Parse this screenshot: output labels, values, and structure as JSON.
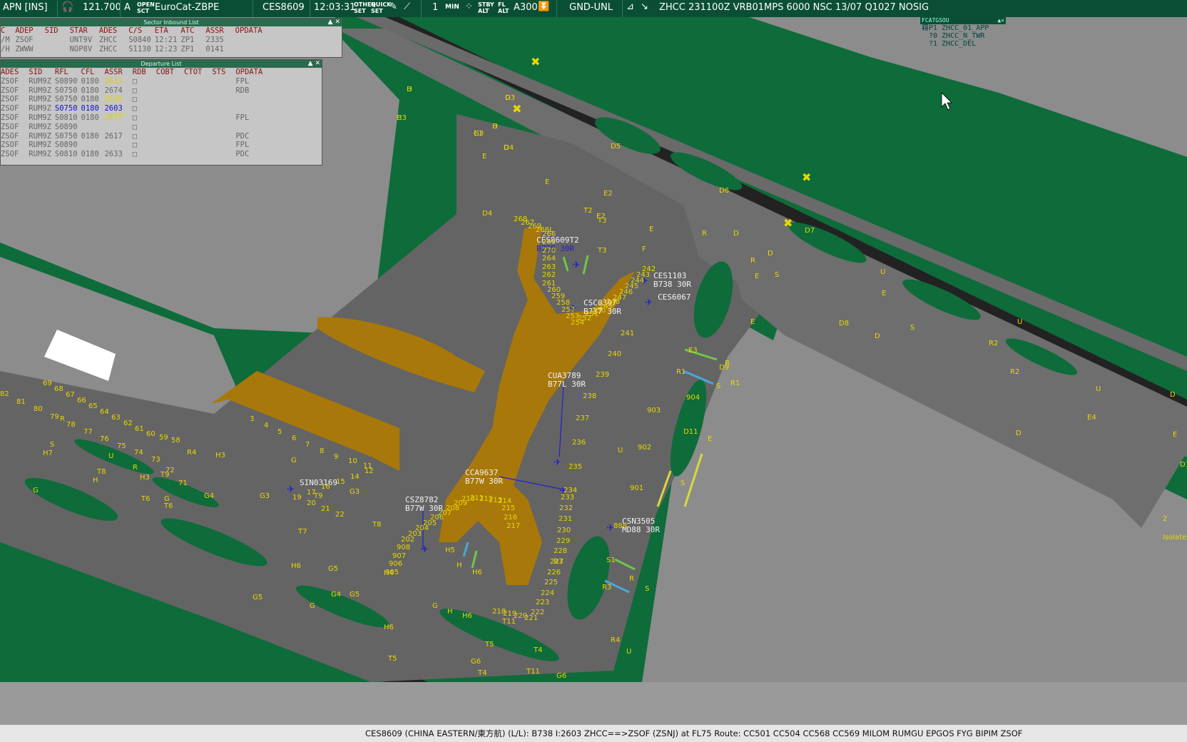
{
  "topbar": {
    "position_label": "APN [INS]",
    "frequency": "121.700",
    "mode": "A",
    "open_sct": [
      "OPEN",
      "SCT"
    ],
    "system_name": "EuroCat-ZBPE",
    "callsign": "CES8609",
    "time": "12:03:31",
    "other_set": [
      "OTHER",
      "SET"
    ],
    "quick_set": [
      "QUICK",
      "SET"
    ],
    "range_value": "1",
    "min_label": "MIN",
    "stby_alt": [
      "STBY",
      "ALT"
    ],
    "fl_alt": [
      "FL",
      "ALT"
    ],
    "alt_filter": "A300",
    "unit_label": "GND-UNL",
    "metar": "ZHCC 231100Z VRB01MPS 6000 NSC 13/07 Q1027 NOSIG"
  },
  "inbound_list": {
    "title": "Sector Inbound List",
    "columns": [
      "C",
      "ADEP",
      "SID",
      "STAR",
      "ADES",
      "C/S",
      "ETA",
      "ATC",
      "ASSR",
      "OPDATA"
    ],
    "rows": [
      [
        "/M",
        "ZSOF",
        "",
        "UNT9V",
        "ZHCC",
        "S0840",
        "12:21",
        "ZP1",
        "2335",
        ""
      ],
      [
        "/H",
        "ZWWW",
        "",
        "NOP8V",
        "ZHCC",
        "S1130",
        "12:23",
        "ZP1",
        "0141",
        ""
      ]
    ]
  },
  "departure_list": {
    "title": "Departure List",
    "columns": [
      "ADES",
      "SID",
      "RFL",
      "CFL",
      "ASSR",
      "RDB",
      "COBT",
      "CTOT",
      "STS",
      "OPDATA"
    ],
    "rows": [
      {
        "ades": "ZSOF",
        "sid": "RUM9Z",
        "rfl": "S0890",
        "cfl": "0180",
        "assr": "2613",
        "rdb": "□",
        "opdata": "FPL",
        "hl": "assr"
      },
      {
        "ades": "ZSOF",
        "sid": "RUM9Z",
        "rfl": "S0750",
        "cfl": "0180",
        "assr": "2674",
        "rdb": "□",
        "opdata": "RDB",
        "hl": ""
      },
      {
        "ades": "ZSOF",
        "sid": "RUM9Z",
        "rfl": "S0750",
        "cfl": "0180",
        "assr": "2636",
        "rdb": "□",
        "opdata": "",
        "hl": "assr"
      },
      {
        "ades": "ZSOF",
        "sid": "RUM9Z",
        "rfl": "S0750",
        "cfl": "0180",
        "assr": "2603",
        "rdb": "□",
        "opdata": "",
        "hl": "blue"
      },
      {
        "ades": "ZSOF",
        "sid": "RUM9Z",
        "rfl": "S0810",
        "cfl": "0180",
        "assr": "2677",
        "rdb": "□",
        "opdata": "FPL",
        "hl": "assr"
      },
      {
        "ades": "ZSOF",
        "sid": "RUM9Z",
        "rfl": "S0890",
        "cfl": "",
        "assr": "",
        "rdb": "□",
        "opdata": "",
        "hl": ""
      },
      {
        "ades": "ZSOF",
        "sid": "RUM9Z",
        "rfl": "S0750",
        "cfl": "0180",
        "assr": "2617",
        "rdb": "□",
        "opdata": "PDC",
        "hl": ""
      },
      {
        "ades": "ZSOF",
        "sid": "RUM9Z",
        "rfl": "S0890",
        "cfl": "",
        "assr": "",
        "rdb": "□",
        "opdata": "FPL",
        "hl": ""
      },
      {
        "ades": "ZSOF",
        "sid": "RUM9Z",
        "rfl": "S0810",
        "cfl": "0180",
        "assr": "2633",
        "rdb": "□",
        "opdata": "PDC",
        "hl": ""
      }
    ]
  },
  "fcat": {
    "header": "FCATGSOU",
    "items": [
      "籍P1 ZHCC_01_APP",
      "?0 ZHCC_N_TWR",
      "?1 ZHCC_DEL"
    ]
  },
  "aircraft": [
    {
      "callsign": "CES8609T2",
      "type": "B738 30R",
      "selected": true
    },
    {
      "callsign": "CES1103",
      "type": "B738 30R",
      "selected": false
    },
    {
      "callsign": "CES6067",
      "type": "",
      "selected": false
    },
    {
      "callsign": "CSC0397",
      "type": "B737 30R",
      "selected": false
    },
    {
      "callsign": "CUA3789",
      "type": "B77L 30R",
      "selected": false
    },
    {
      "callsign": "CCA9637",
      "type": "B77W 30R",
      "selected": false
    },
    {
      "callsign": "CSZ8782",
      "type": "B77W 30R",
      "selected": false
    },
    {
      "callsign": "SIN03169",
      "type": "",
      "selected": false
    },
    {
      "callsign": "CSN3505",
      "type": "MD88 30R",
      "selected": false
    }
  ],
  "map_labels": {
    "taxiways": [
      "D2",
      "D",
      "E",
      "D3",
      "D",
      "E1",
      "D4",
      "E",
      "D5",
      "E",
      "E2",
      "T2",
      "E2",
      "T3",
      "T3",
      "F",
      "D6",
      "E",
      "D4",
      "R",
      "D",
      "D7",
      "D",
      "R",
      "E",
      "S",
      "U",
      "E",
      "D8",
      "D",
      "E",
      "S",
      "U",
      "E3",
      "D9",
      "R",
      "R1",
      "S",
      "R1",
      "R2",
      "R2",
      "U",
      "E4",
      "D",
      "D",
      "E",
      "D11",
      "D11",
      "E",
      "S",
      "U",
      "S1",
      "R",
      "R3",
      "S",
      "R3",
      "R4",
      "U",
      "R4",
      "R",
      "S",
      "U",
      "T8",
      "H3",
      "T9",
      "H3",
      "G",
      "G3",
      "T9",
      "G3",
      "T8",
      "G4",
      "T6",
      "T7",
      "G5",
      "T6",
      "H6",
      "G5",
      "G4",
      "H4",
      "G5",
      "G",
      "H6",
      "H5",
      "H",
      "H6",
      "G",
      "H",
      "H6",
      "T11",
      "T5",
      "G6",
      "T4",
      "T5",
      "G6",
      "T4",
      "T11",
      "G",
      "H",
      "H7",
      "R",
      "G",
      "R",
      "H",
      "H3",
      "G",
      "H",
      "G3",
      "G"
    ],
    "stands": [
      "268",
      "267",
      "269",
      "266L",
      "266",
      "265",
      "270",
      "264",
      "263",
      "262",
      "261",
      "260",
      "259",
      "258",
      "257",
      "253",
      "254",
      "252",
      "251",
      "250",
      "249",
      "248",
      "247",
      "246",
      "245",
      "244",
      "243",
      "242",
      "241",
      "240",
      "239",
      "238",
      "237",
      "236",
      "235",
      "234",
      "233",
      "232",
      "231",
      "230",
      "229",
      "228",
      "227",
      "226",
      "225",
      "224",
      "223",
      "222",
      "221",
      "220",
      "219",
      "218",
      "217",
      "216",
      "215",
      "214",
      "213",
      "212",
      "211",
      "210",
      "209",
      "208",
      "207",
      "206",
      "205",
      "204",
      "203",
      "202",
      "908",
      "907",
      "906",
      "905",
      "904",
      "903",
      "902",
      "901",
      "888",
      "2",
      "3",
      "4",
      "5",
      "6",
      "7",
      "8",
      "9",
      "10",
      "11",
      "12",
      "14",
      "15",
      "16",
      "17",
      "19",
      "20",
      "21",
      "22",
      "69",
      "68",
      "67",
      "66",
      "65",
      "64",
      "63",
      "62",
      "61",
      "60",
      "59",
      "58",
      "82",
      "81",
      "80",
      "79",
      "78",
      "77",
      "76",
      "75",
      "74",
      "73",
      "72",
      "71"
    ],
    "isolated": "Isolated"
  },
  "status_bar": {
    "text": "CES8609 (CHINA EASTERN/東方航) (L/L): B738 I:2603 ZHCC==>ZSOF (ZSNJ) at FL75 Route: CC501 CC504 CC568 CC569 MILOM RUMGU EPGOS FYG BIPIM ZSOF"
  },
  "colors": {
    "grass": "#0e6b3a",
    "paved": "#6e6e6e",
    "apron": "#5a5a5a",
    "terminal": "#a8780a",
    "label": "#e8d800",
    "selected": "#2222cc",
    "topbar": "#0a4f35"
  }
}
